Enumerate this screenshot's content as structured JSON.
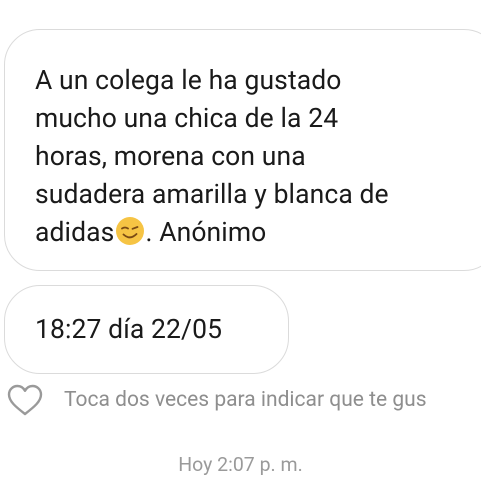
{
  "message": {
    "lines": [
      "A un colega le ha gustado",
      "mucho una chica de la 24",
      "horas, morena con una",
      "sudadera amarilla y blanca de"
    ],
    "last_line_before_emoji": "adidas",
    "emoji": "winking-face",
    "last_line_after_emoji": ". Anónimo"
  },
  "reply": {
    "text": "18:27 día 22/05"
  },
  "like": {
    "icon": "heart-outline-icon",
    "hint": "Toca dos veces para indicar que te gus"
  },
  "timestamp": {
    "text": "Hoy 2:07 p. m."
  },
  "colors": {
    "bubble_border": "#dbdbdb",
    "text": "#1a1a1a",
    "hint": "#8e8e8e",
    "emoji": "#f6c444"
  }
}
